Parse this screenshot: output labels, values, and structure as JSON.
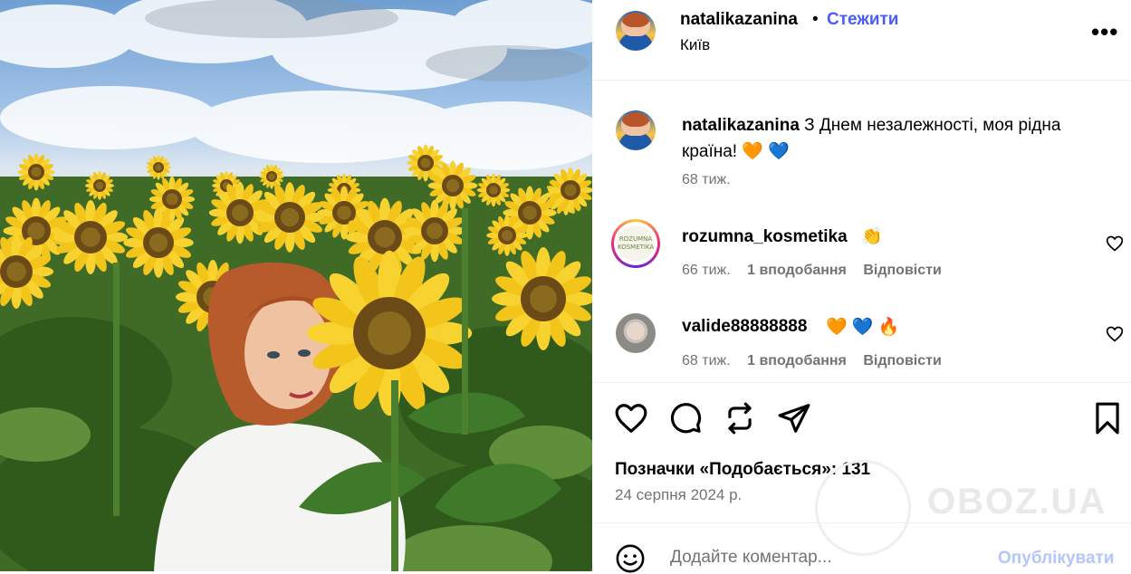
{
  "post": {
    "image_alt": "",
    "author": "natalikazanina",
    "separator": "•",
    "follow_label": "Стежити",
    "location": "Київ",
    "more_label": "•••"
  },
  "caption": {
    "author": "natalikazanina",
    "text": "З Днем незалежності, моя рідна країна! 🧡 💙",
    "time": "68 тиж."
  },
  "comments": [
    {
      "author": "rozumna_kosmetika",
      "text": "👏",
      "time": "66 тиж.",
      "likes": "1 вподобання",
      "reply": "Відповісти",
      "avatar_text": "ROZUMNA KOSMETIKA"
    },
    {
      "author": "valide88888888",
      "text": "🧡 💙 🔥",
      "time": "68 тиж.",
      "likes": "1 вподобання",
      "reply": "Відповісти"
    }
  ],
  "likes": {
    "label": "Позначки «Подобається»:",
    "count": "131"
  },
  "date": "24 серпня 2024 р.",
  "watermark": "OBOZ.UA",
  "composer": {
    "placeholder": "Додайте коментар...",
    "publish_label": "Опублікувати"
  },
  "icons": {
    "like": "heart-icon",
    "comment": "comment-bubble-icon",
    "repost": "repost-icon",
    "share": "paper-plane-icon",
    "save": "bookmark-icon",
    "emoji": "smiley-icon",
    "more": "more-dots-icon"
  },
  "colors": {
    "accent": "#4a5df9",
    "muted": "#737373",
    "publish_disabled": "#b3c6fb",
    "divider": "#efefef"
  }
}
